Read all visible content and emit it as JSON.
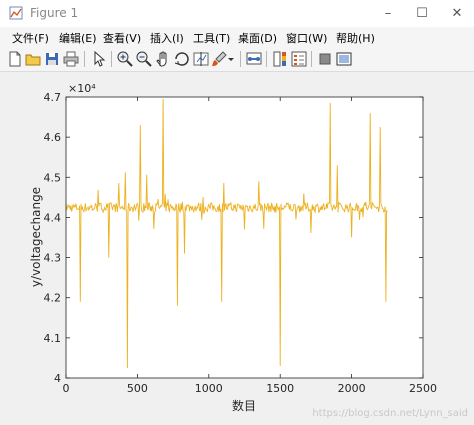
{
  "window": {
    "title": "Figure 1",
    "minimize": "–",
    "maximize": "☐",
    "close": "✕"
  },
  "menu": [
    "文件(F)",
    "编辑(E)",
    "查看(V)",
    "插入(I)",
    "工具(T)",
    "桌面(D)",
    "窗口(W)",
    "帮助(H)"
  ],
  "toolbar_icons": [
    "new-figure-icon",
    "open-file-icon",
    "save-icon",
    "print-icon",
    "pointer-icon",
    "zoom-in-icon",
    "zoom-out-icon",
    "pan-icon",
    "rotate-3d-icon",
    "data-cursor-icon",
    "brush-icon",
    "link-plot-icon",
    "colorbar-icon",
    "legend-icon",
    "hide-plot-tools-icon",
    "show-plot-tools-icon"
  ],
  "colors": {
    "line": "#EDB120",
    "axes_bg": "#ffffff",
    "figure_bg": "#f0f0f0"
  },
  "watermark": "https://blog.csdn.net/Lynn_said",
  "chart_data": {
    "type": "line",
    "xlabel": "数目",
    "ylabel": "y/voltagechange",
    "exponent_label": "×10⁴",
    "xlim": [
      0,
      2500
    ],
    "ylim": [
      40000,
      47000
    ],
    "xticks": [
      "0",
      "500",
      "1000",
      "1500",
      "2000",
      "2500"
    ],
    "yticks": [
      "4",
      "4.1",
      "4.2",
      "4.3",
      "4.4",
      "4.5",
      "4.6",
      "4.7"
    ],
    "series": [
      {
        "baseline": 44250,
        "n_points": 2250,
        "spikes": [
          {
            "x": 100,
            "y": 41900
          },
          {
            "x": 300,
            "y": 43000
          },
          {
            "x": 430,
            "y": 40250
          },
          {
            "x": 520,
            "y": 46300
          },
          {
            "x": 680,
            "y": 46950
          },
          {
            "x": 780,
            "y": 41800
          },
          {
            "x": 830,
            "y": 43100
          },
          {
            "x": 1090,
            "y": 41900
          },
          {
            "x": 1250,
            "y": 43700
          },
          {
            "x": 1350,
            "y": 44900
          },
          {
            "x": 1500,
            "y": 40300
          },
          {
            "x": 1850,
            "y": 46850
          },
          {
            "x": 1900,
            "y": 45300
          },
          {
            "x": 2000,
            "y": 43500
          },
          {
            "x": 2130,
            "y": 46600
          },
          {
            "x": 2200,
            "y": 46250
          },
          {
            "x": 2240,
            "y": 41900
          }
        ]
      }
    ]
  }
}
